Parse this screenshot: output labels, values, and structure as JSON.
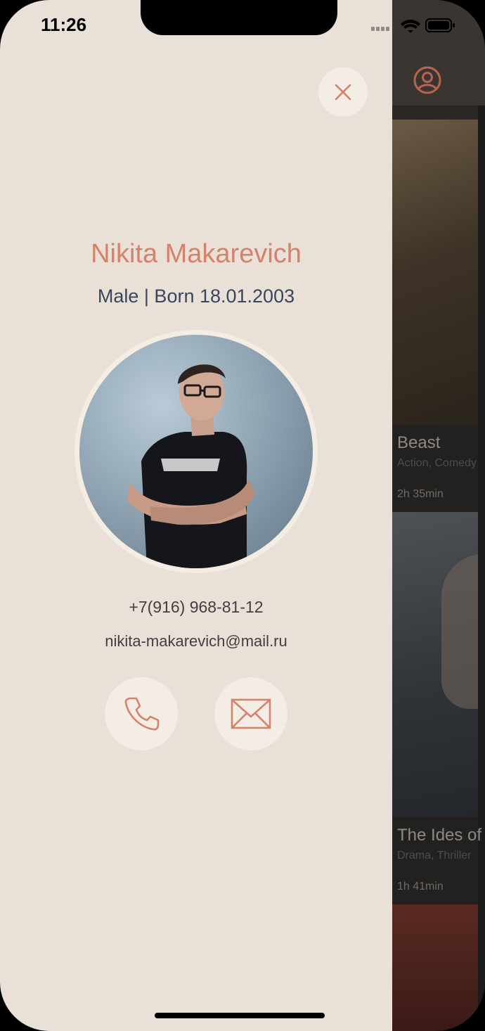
{
  "status_bar": {
    "time": "11:26"
  },
  "profile": {
    "name": "Nikita Makarevich",
    "subtitle": "Male | Born 18.01.2003",
    "phone": "+7(916) 968-81-12",
    "email": "nikita-makarevich@mail.ru"
  },
  "icons": {
    "close": "close-icon",
    "call": "phone-icon",
    "mail": "envelope-icon",
    "profile": "user-circle-icon"
  },
  "colors": {
    "accent": "#d4826a",
    "drawer_background": "#e9e1d7",
    "button_background": "#f3ede6",
    "subtitle_text": "#39455c"
  },
  "movies": [
    {
      "title": "Beast",
      "genres": "Action, Comedy",
      "duration": "2h 35min"
    },
    {
      "title": "The Ides of March",
      "genres": "Drama, Thriller",
      "duration": "1h 41min"
    }
  ]
}
